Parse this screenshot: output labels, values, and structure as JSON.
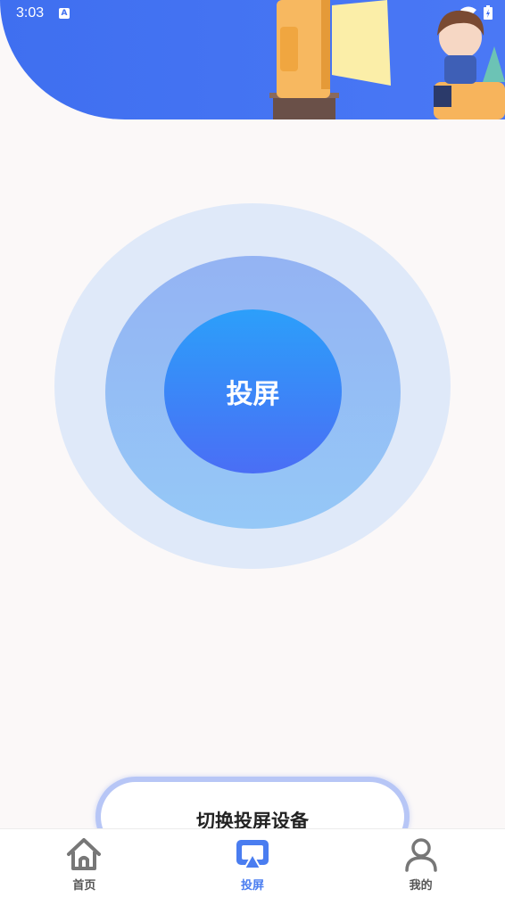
{
  "status_bar": {
    "time": "3:03"
  },
  "main": {
    "cast_button_label": "投屏",
    "switch_device_label": "切换投屏设备"
  },
  "bottom_nav": {
    "items": [
      {
        "label": "首页",
        "icon": "home-icon",
        "active": false
      },
      {
        "label": "投屏",
        "icon": "cast-screen-icon",
        "active": true
      },
      {
        "label": "我的",
        "icon": "person-icon",
        "active": false
      }
    ]
  },
  "colors": {
    "header_blue": "#3f6ff0",
    "accent_blue": "#4a7df0",
    "inactive_gray": "#555555",
    "background": "#fbf8f8"
  }
}
